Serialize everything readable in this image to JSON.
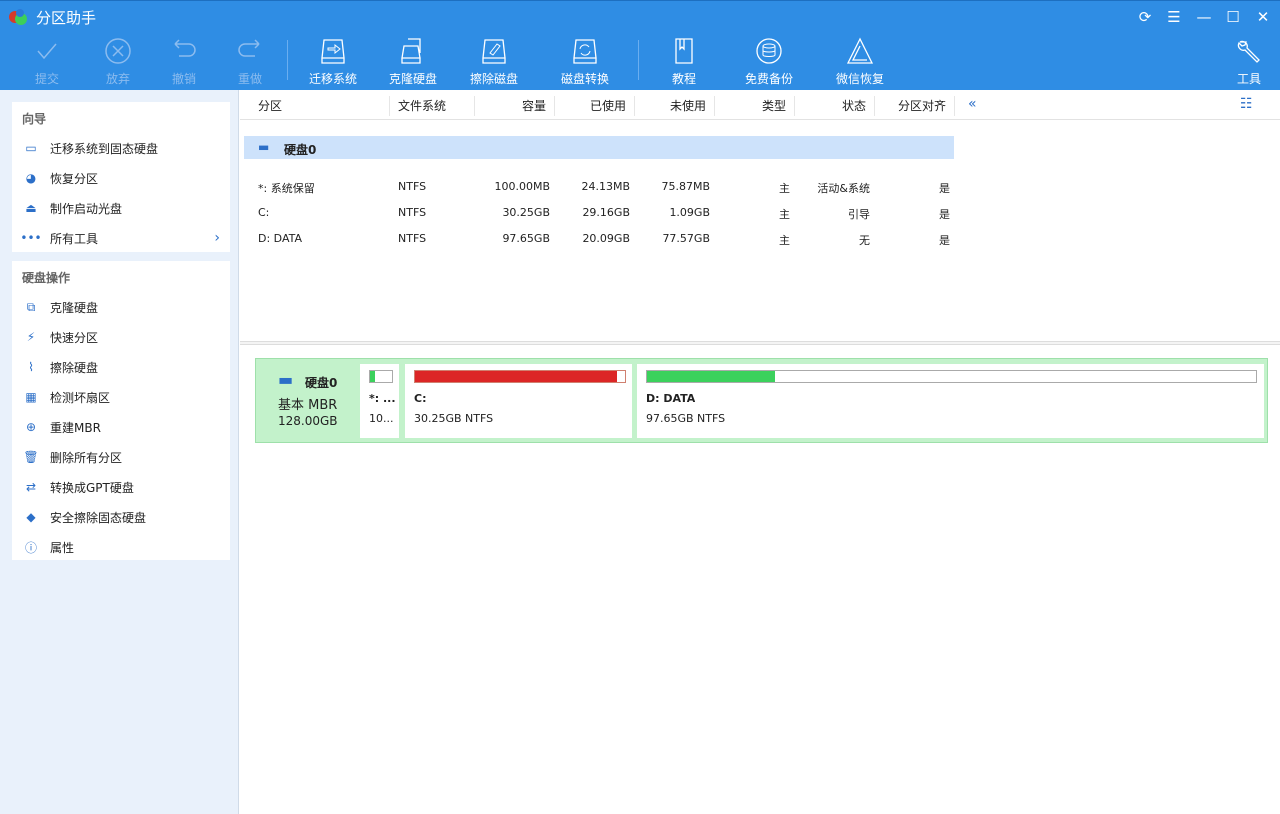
{
  "app": {
    "title": "分区助手"
  },
  "toolbar": {
    "items": [
      {
        "label": "提交",
        "icon": "check-icon",
        "enabled": false
      },
      {
        "label": "放弃",
        "icon": "cancel-circle-icon",
        "enabled": false
      },
      {
        "label": "撤销",
        "icon": "undo-icon",
        "enabled": false
      },
      {
        "label": "重做",
        "icon": "redo-icon",
        "enabled": false
      },
      {
        "label": "迁移系统",
        "icon": "migrate-disk-icon",
        "enabled": true
      },
      {
        "label": "克隆硬盘",
        "icon": "clone-disk-icon",
        "enabled": true
      },
      {
        "label": "擦除磁盘",
        "icon": "wipe-disk-icon",
        "enabled": true
      },
      {
        "label": "磁盘转换",
        "icon": "convert-disk-icon",
        "enabled": true
      },
      {
        "label": "教程",
        "icon": "book-icon",
        "enabled": true
      },
      {
        "label": "免费备份",
        "icon": "backup-icon",
        "enabled": true
      },
      {
        "label": "微信恢复",
        "icon": "recovery-icon",
        "enabled": true
      },
      {
        "label": "工具",
        "icon": "tools-icon",
        "enabled": true
      }
    ]
  },
  "sidebar": {
    "wizard": {
      "title": "向导",
      "items": [
        "迁移系统到固态硬盘",
        "恢复分区",
        "制作启动光盘",
        "所有工具"
      ]
    },
    "disk_ops": {
      "title": "硬盘操作",
      "items": [
        "克隆硬盘",
        "快速分区",
        "擦除硬盘",
        "检测坏扇区",
        "重建MBR",
        "删除所有分区",
        "转换成GPT硬盘",
        "安全擦除固态硬盘",
        "属性"
      ]
    }
  },
  "table": {
    "columns": [
      "分区",
      "文件系统",
      "容量",
      "已使用",
      "未使用",
      "类型",
      "状态",
      "分区对齐"
    ],
    "disk": "硬盘0",
    "rows": [
      [
        "*: 系统保留",
        "NTFS",
        "100.00MB",
        "24.13MB",
        "75.87MB",
        "主",
        "活动&系统",
        "是"
      ],
      [
        "C:",
        "NTFS",
        "30.25GB",
        "29.16GB",
        "1.09GB",
        "主",
        "引导",
        "是"
      ],
      [
        "D: DATA",
        "NTFS",
        "97.65GB",
        "20.09GB",
        "77.57GB",
        "主",
        "无",
        "是"
      ]
    ]
  },
  "diskmap": {
    "name": "硬盘0",
    "type": "基本 MBR",
    "size": "128.00GB",
    "partitions": [
      {
        "name": "*: ...",
        "info": "10...",
        "used_fraction": 0.24,
        "color": "#3bd15c"
      },
      {
        "name": "C:",
        "info": "30.25GB NTFS",
        "used_fraction": 0.96,
        "color": "#dc2626"
      },
      {
        "name": "D: DATA",
        "info": "97.65GB NTFS",
        "used_fraction": 0.21,
        "color": "#3bd15c"
      }
    ]
  }
}
